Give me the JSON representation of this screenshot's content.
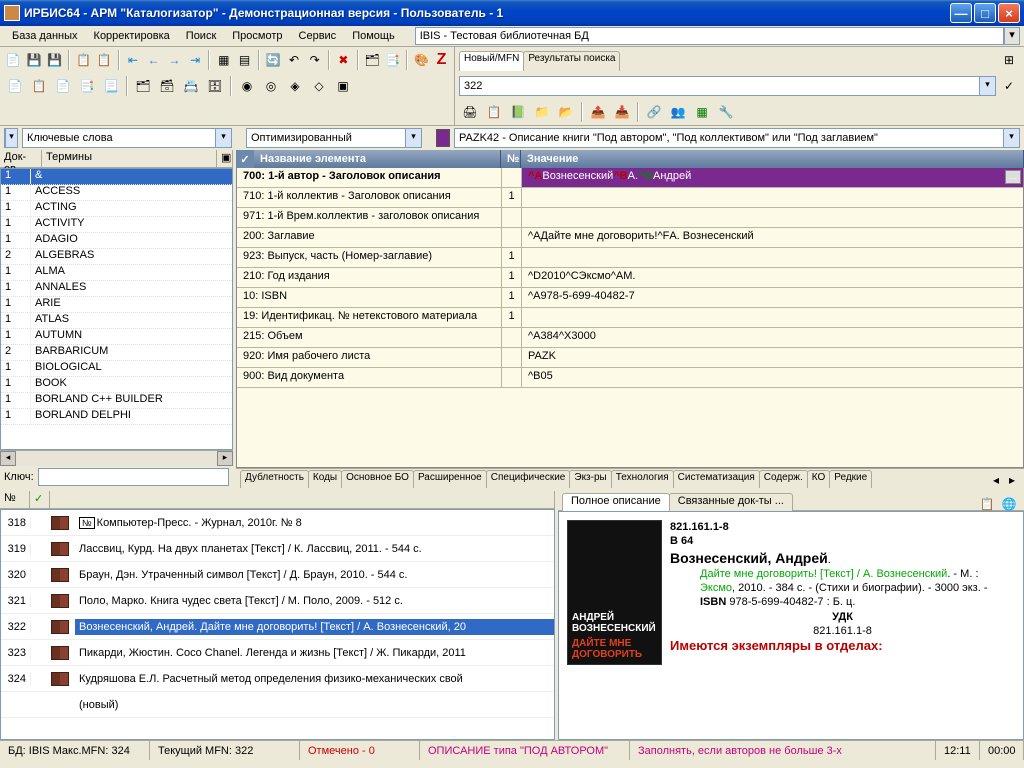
{
  "title": "ИРБИС64 - АРМ \"Каталогизатор\" - Демонстрационная версия - Пользователь - 1",
  "menu": [
    "База данных",
    "Корректировка",
    "Поиск",
    "Просмотр",
    "Сервис",
    "Помощь"
  ],
  "db_select": "IBIS - Тестовая библиотечная БД",
  "tabs_top": {
    "new": "Новый/MFN",
    "results": "Результаты поиска"
  },
  "mfn_input": "322",
  "left_combo_small": "",
  "keyword_combo": "Ключевые слова",
  "optimized_combo": "Оптимизированный",
  "format_combo": "PAZK42 - Описание книги \"Под автором\", \"Под коллективом\" или \"Под заглавием\"",
  "terms_headers": {
    "c1": "Док-ов",
    "c2": "Термины",
    "pin": "▣"
  },
  "terms": [
    {
      "n": "1",
      "t": "&",
      "sel": true
    },
    {
      "n": "1",
      "t": "ACCESS"
    },
    {
      "n": "1",
      "t": "ACTING"
    },
    {
      "n": "1",
      "t": "ACTIVITY"
    },
    {
      "n": "1",
      "t": "ADAGIO"
    },
    {
      "n": "2",
      "t": "ALGEBRAS"
    },
    {
      "n": "1",
      "t": "ALMA"
    },
    {
      "n": "1",
      "t": "ANNALES"
    },
    {
      "n": "1",
      "t": "ARIE"
    },
    {
      "n": "1",
      "t": "ATLAS"
    },
    {
      "n": "1",
      "t": "AUTUMN"
    },
    {
      "n": "2",
      "t": "BARBARICUM"
    },
    {
      "n": "1",
      "t": "BIOLOGICAL"
    },
    {
      "n": "1",
      "t": "BOOK"
    },
    {
      "n": "1",
      "t": "BORLAND C++ BUILDER"
    },
    {
      "n": "1",
      "t": "BORLAND DELPHI"
    }
  ],
  "key_label": "Ключ:",
  "key_value": "",
  "fields_headers": {
    "name": "Название элемента",
    "no": "№",
    "value": "Значение"
  },
  "fields": [
    {
      "n": "700: 1-й  автор - Заголовок описания",
      "c": "",
      "v": "^A Вознесенский^B А.^G Андрей",
      "sel": true,
      "rich": true
    },
    {
      "n": "710: 1-й коллектив - Заголовок описания",
      "c": "1",
      "v": ""
    },
    {
      "n": "971: 1-й Врем.коллектив - заголовок описания",
      "c": "",
      "v": ""
    },
    {
      "n": "200: Заглавие",
      "c": "",
      "v": "^AДайте мне договорить!^FА. Вознесенский"
    },
    {
      "n": "923: Выпуск, часть (Номер-заглавие)",
      "c": "1",
      "v": ""
    },
    {
      "n": "210: Год издания",
      "c": "1",
      "v": "^D2010^CЭксмо^AМ."
    },
    {
      "n": "10: ISBN",
      "c": "1",
      "v": "^A978-5-699-40482-7"
    },
    {
      "n": "19: Идентификац. № нетекстового материала",
      "c": "1",
      "v": ""
    },
    {
      "n": "215: Объем",
      "c": "",
      "v": "^A384^X3000"
    },
    {
      "n": "920: Имя рабочего листа",
      "c": "",
      "v": "PAZK"
    },
    {
      "n": "900: Вид документа",
      "c": "",
      "v": "^B05"
    }
  ],
  "bottom_tabs": [
    "Дублетность",
    "Коды",
    "Основное БО",
    "Расширенное",
    "Специфические",
    "Экз-ры",
    "Технология",
    "Систематизация",
    "Содерж.",
    "КО",
    "Редкие"
  ],
  "num_lbl": "№",
  "records": [
    {
      "n": "318",
      "t": "Компьютер-Пресс. - Журнал, 2010г. № 8",
      "numbadge": true
    },
    {
      "n": "319",
      "t": "Лассвиц, Курд. На двух планетах [Текст] / К. Лассвиц, 2011. - 544 с."
    },
    {
      "n": "320",
      "t": "Браун, Дэн. Утраченный символ [Текст] / Д. Браун, 2010. - 544 с."
    },
    {
      "n": "321",
      "t": "Поло, Марко. Книга чудес света [Текст] / М. Поло, 2009. - 512 с."
    },
    {
      "n": "322",
      "t": "Вознесенский, Андрей. Дайте мне договорить! [Текст] / А. Вознесенский, 20",
      "sel": true
    },
    {
      "n": "323",
      "t": "Пикарди, Жюстин. Coco Chanel. Легенда и жизнь [Текст] / Ж. Пикарди, 2011"
    },
    {
      "n": "324",
      "t": "Кудряшова Е.Л. Расчетный метод определения физико-механических свой"
    },
    {
      "n": "",
      "t": "(новый)",
      "new": true
    }
  ],
  "desc_tabs": {
    "full": "Полное описание",
    "linked": "Связанные док-ты ..."
  },
  "biblio": {
    "cls1": "821.161.1-8",
    "cls2": "В 64",
    "author": "Вознесенский, Андрей",
    "title": "Дайте мне договорить! [Текст] / А. Вознесенский",
    "place": "М.",
    "publisher": "Эксмо",
    "year": "2010",
    "pages": "384 с.",
    "series": "(Стихи и биографии)",
    "copies": "3000 экз.",
    "isbn_lbl": "ISBN",
    "isbn": "978-5-699-40482-7",
    "price": "Б. ц.",
    "udk_lbl": "УДК",
    "udk": "821.161.1-8",
    "holdings": "Имеются экземпляры в отделах:"
  },
  "cover_text": {
    "l1": "АНДРЕЙ",
    "l2": "ВОЗНЕСЕНСКИЙ",
    "l3": "ДАЙТЕ МНЕ",
    "l4": "ДОГОВОРИТЬ"
  },
  "status": {
    "db": "БД: IBIS Макс.MFN: 324",
    "cur": "Текущий MFN: 322",
    "marked": "Отмечено - 0",
    "rec_type": "ОПИСАНИЕ типа \"ПОД АВТОРОМ\"",
    "hint": "Заполнять, если авторов не больше 3-х",
    "time": "12:11",
    "tstamp": "00:00"
  }
}
